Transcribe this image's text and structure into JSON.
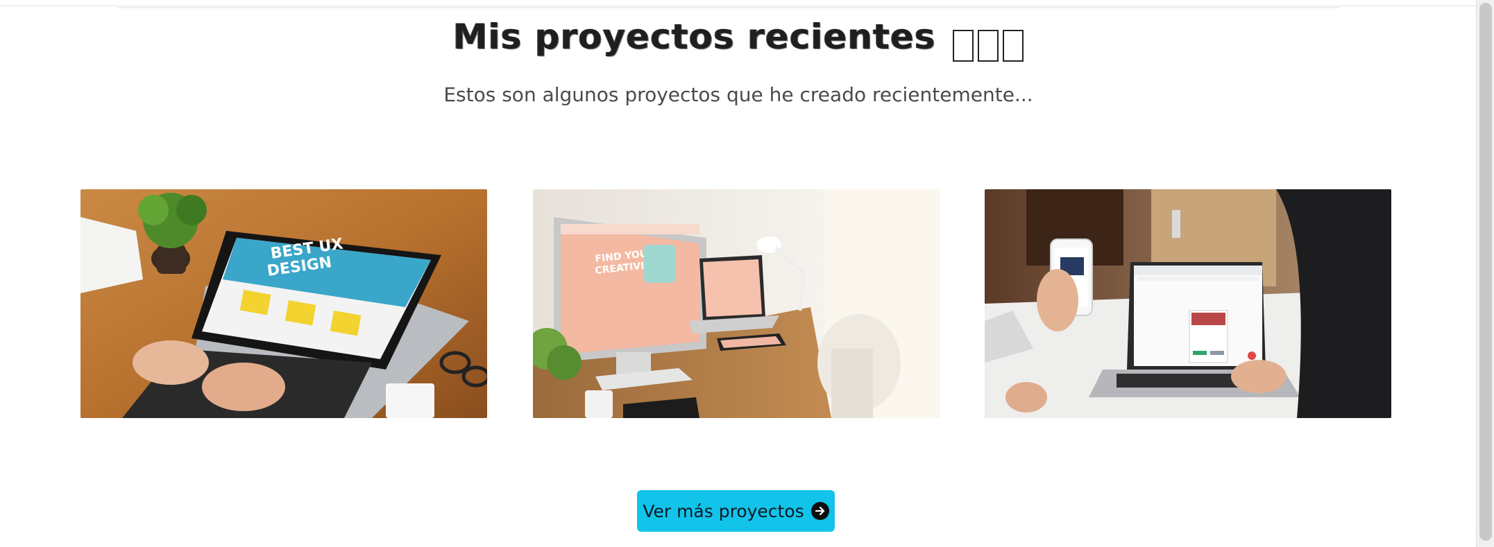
{
  "section": {
    "title": "Mis proyectos recientes",
    "subtitle": "Estos son algunos proyectos que he creado recientemente...",
    "cta_label": "Ver más proyectos",
    "cta_icon": "arrow-right-circle-icon"
  },
  "projects": [
    {
      "image": "laptop-web-design-photo",
      "screen_text_1": "BEST UX",
      "screen_text_2": "DESIGN"
    },
    {
      "image": "desktop-responsive-mockup-photo",
      "screen_text_1": "FIND YOUR",
      "screen_text_2": "CREATIVITY"
    },
    {
      "image": "phone-and-laptop-app-photo"
    }
  ],
  "colors": {
    "accent": "#12c3ea",
    "title": "#1f1f1f",
    "subtitle": "#4a4a4a"
  }
}
